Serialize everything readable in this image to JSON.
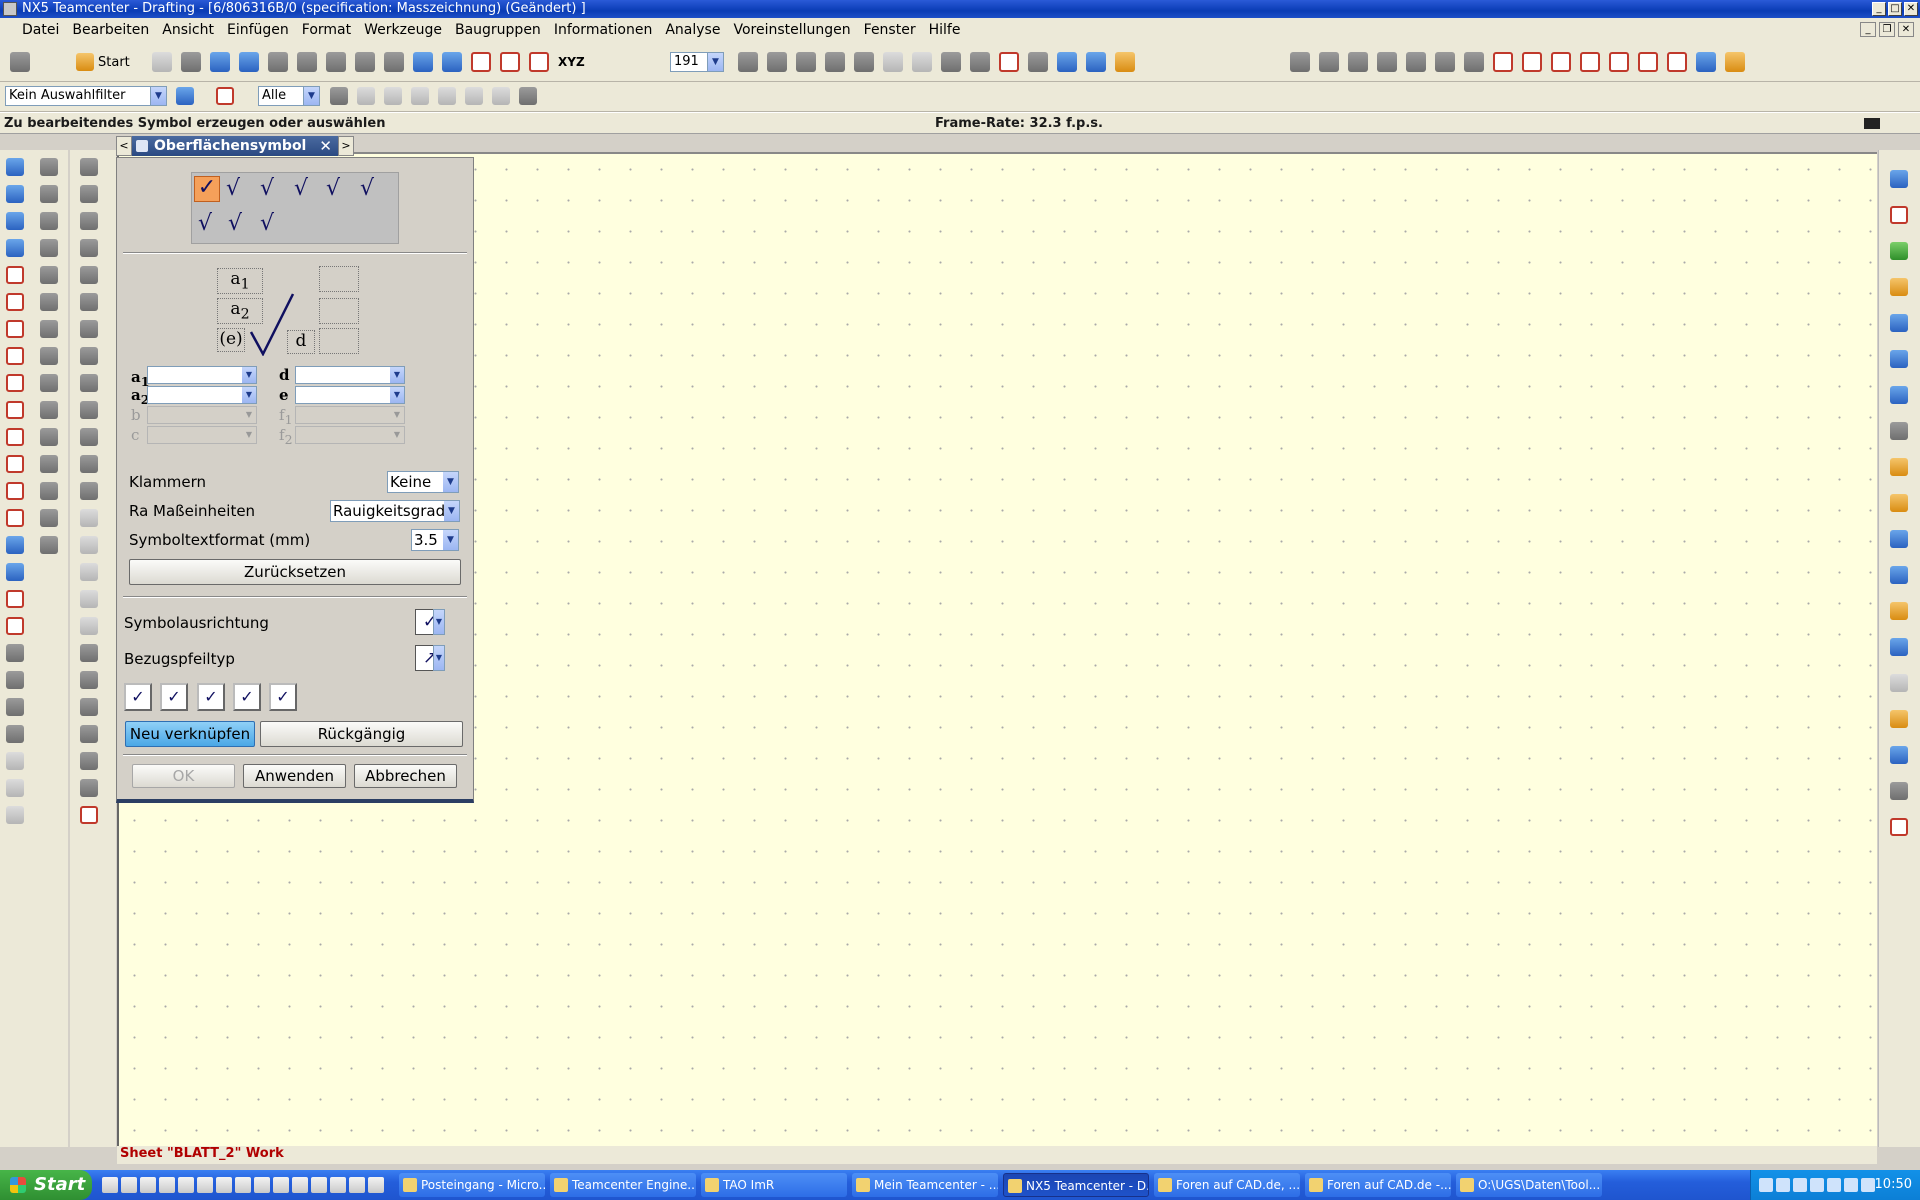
{
  "window": {
    "title": "NX5 Teamcenter - Drafting - [6/806316B/0 (specification: Masszeichnung) (Geändert) ]"
  },
  "menu": [
    "Datei",
    "Bearbeiten",
    "Ansicht",
    "Einfügen",
    "Format",
    "Werkzeuge",
    "Baugruppen",
    "Informationen",
    "Analyse",
    "Voreinstellungen",
    "Fenster",
    "Hilfe"
  ],
  "toolbar": {
    "start_label": "Start",
    "layer_value": "191",
    "xyz_label": "XYZ"
  },
  "filter": {
    "selection_filter": "Kein Auswahlfilter",
    "scope": "Alle"
  },
  "cue": {
    "message": "Zu bearbeitendes Symbol erzeugen oder auswählen",
    "frame_rate": "Frame-Rate: 32.3 f.p.s."
  },
  "dialog": {
    "title": "Oberflächensymbol",
    "graphic": {
      "a1": "a",
      "a1_sub": "1",
      "a2": "a",
      "a2_sub": "2",
      "e": "(e)",
      "d": "d"
    },
    "fields": {
      "a1": "a",
      "a1_sub": "1",
      "a2": "a",
      "a2_sub": "2",
      "b": "b",
      "c": "c",
      "d": "d",
      "e": "e",
      "f1": "f",
      "f1_sub": "1",
      "f2": "f",
      "f2_sub": "2"
    },
    "klammern_label": "Klammern",
    "klammern_value": "Keine",
    "ra_label": "Ra Maßeinheiten",
    "ra_value": "Rauigkeitsgrad",
    "textformat_label": "Symboltextformat (mm)",
    "textformat_value": "3.5",
    "reset_label": "Zurücksetzen",
    "orientation_label": "Symbolausrichtung",
    "arrow_label": "Bezugspfeiltyp",
    "relink_label": "Neu verknüpfen",
    "undo_label": "Rückgängig",
    "ok_label": "OK",
    "apply_label": "Anwenden",
    "cancel_label": "Abbrechen"
  },
  "status": {
    "sheet": "Sheet \"BLATT_2\" Work"
  },
  "taskbar": {
    "start": "Start",
    "tasks": [
      "Posteingang - Micro...",
      "Teamcenter Engine...",
      "TAO ImR",
      "Mein Teamcenter - ...",
      "NX5 Teamcenter - D...",
      "Foren auf CAD.de, ...",
      "Foren auf CAD.de -...",
      "O:\\UGS\\Daten\\Tool..."
    ],
    "active_task_index": 4,
    "clock": "10:50"
  }
}
